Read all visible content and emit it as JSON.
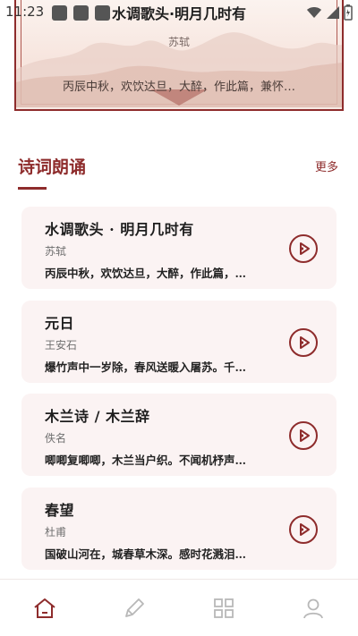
{
  "status_bar": {
    "time": "11:23"
  },
  "banner": {
    "title": "水调歌头·明月几时有",
    "author": "苏轼",
    "excerpt": "丙辰中秋，欢饮达旦，大醉，作此篇，兼怀…"
  },
  "section": {
    "title": "诗词朗诵",
    "more": "更多"
  },
  "poems": [
    {
      "title": "水调歌头 · 明月几时有",
      "author": "苏轼",
      "excerpt": "丙辰中秋，欢饮达旦，大醉，作此篇，…"
    },
    {
      "title": "元日",
      "author": "王安石",
      "excerpt": "爆竹声中一岁除，春风送暖入屠苏。千…"
    },
    {
      "title": "木兰诗 / 木兰辞",
      "author": "佚名",
      "excerpt": "唧唧复唧唧，木兰当户织。不闻机杼声…"
    },
    {
      "title": "春望",
      "author": "杜甫",
      "excerpt": "国破山河在，城春草木深。感时花溅泪…"
    }
  ],
  "nav": {
    "items": [
      {
        "icon": "home-icon",
        "active": true
      },
      {
        "icon": "pencil-icon",
        "active": false
      },
      {
        "icon": "grid-icon",
        "active": false
      },
      {
        "icon": "user-icon",
        "active": false
      }
    ]
  },
  "colors": {
    "accent": "#8e2c2c",
    "card_bg": "#fbf3f3",
    "inactive_icon": "#b8b8b8"
  }
}
